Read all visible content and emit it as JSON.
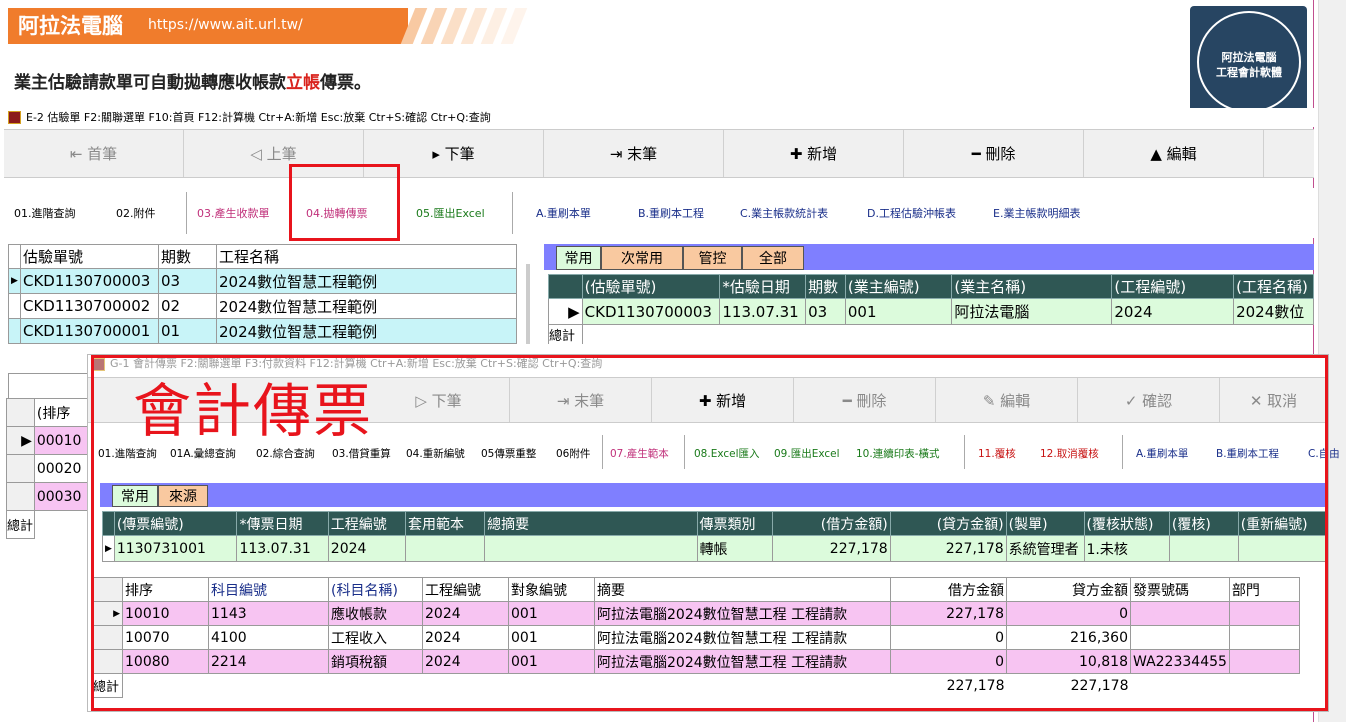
{
  "banner": {
    "title": "阿拉法電腦",
    "url": "https://www.ait.url.tw/"
  },
  "logo": {
    "line1": "阿拉法電腦",
    "line2": "工程會計軟體"
  },
  "subtitle": {
    "pre": "業主估驗請款單可自動拋轉應收帳款",
    "red": "立帳",
    "post": "傳票。"
  },
  "win1": {
    "title": "E-2 估驗單  F2:關聯選單  F10:首頁  F12:計算機  Ctr+A:新增  Esc:放棄  Ctr+S:確認  Ctr+Q:查詢",
    "nav": [
      "⇤ 首筆",
      "◁ 上筆",
      "▸ 下筆",
      "⇥ 末筆",
      "✚ 新增",
      "━ 刪除",
      "▲ 編輯"
    ],
    "funcs": {
      "f1": "01.進階查詢",
      "f2": "02.附件",
      "f3": "03.產生收款單",
      "f4": "04.拋轉傳票",
      "f5": "05.匯出Excel",
      "a": "A.重刷本單",
      "b": "B.重刷本工程",
      "c": "C.業主帳款統計表",
      "d": "D.工程估驗沖帳表",
      "e": "E.業主帳款明細表"
    },
    "left_headers": [
      "估驗單號",
      "期數",
      "工程名稱"
    ],
    "left_rows": [
      [
        "CKD1130700003",
        "03",
        "2024數位智慧工程範例"
      ],
      [
        "CKD1130700002",
        "02",
        "2024數位智慧工程範例"
      ],
      [
        "CKD1130700001",
        "01",
        "2024數位智慧工程範例"
      ]
    ],
    "tabs": [
      "常用",
      "次常用",
      "管控",
      "全部"
    ],
    "right_headers": [
      "(估驗單號)",
      "*估驗日期",
      "期數",
      "(業主編號)",
      "(業主名稱)",
      "(工程編號)",
      "(工程名稱)"
    ],
    "right_row": [
      "CKD1130700003",
      "113.07.31",
      "03",
      "001",
      "阿拉法電腦",
      "2024",
      "2024數位"
    ],
    "total": "總計",
    "sub_header": "(排序",
    "sub_rows": [
      "00010",
      "00020",
      "00030"
    ]
  },
  "win2": {
    "title": "G-1 會計傳票  F2:關聯選單  F3:付款資料  F12:計算機  Ctr+A:新增  Esc:放棄  Ctr+S:確認  Ctr+Q:查詢",
    "stamp": "會計傳票",
    "nav": [
      "▷ 下筆",
      "⇥ 末筆",
      "✚ 新增",
      "━ 刪除",
      "✎ 編輯",
      "✓ 確認",
      "✕ 取消"
    ],
    "funcs": {
      "f1": "01.進階查詢",
      "f1a": "01A.彙總查詢",
      "f2": "02.綜合查詢",
      "f3": "03.借貸重算",
      "f4": "04.重新編號",
      "f5": "05傳票重整",
      "f6": "06附件",
      "f7": "07.產生範本",
      "f8": "08.Excel匯入",
      "f9": "09.匯出Excel",
      "f10": "10.連續印表-橫式",
      "f11": "11.覆核",
      "f12": "12.取消覆核",
      "a": "A.重刷本單",
      "b": "B.重刷本工程",
      "c": "C.自由"
    },
    "tabs": [
      "常用",
      "來源"
    ],
    "head_headers": [
      "(傳票編號)",
      "*傳票日期",
      "工程編號",
      "套用範本",
      "總摘要",
      "傳票類別",
      "(借方金額)",
      "(貸方金額)",
      "(製單)",
      "(覆核狀態)",
      "(覆核)",
      "(重新編號)"
    ],
    "head_row": [
      "1130731001",
      "113.07.31",
      "2024",
      "",
      "",
      "轉帳",
      "227,178",
      "227,178",
      "系統管理者",
      "1.未核",
      "",
      ""
    ],
    "detail_headers": [
      "排序",
      "科目編號",
      "(科目名稱)",
      "工程編號",
      "對象編號",
      "摘要",
      "借方金額",
      "貸方金額",
      "發票號碼",
      "部門"
    ],
    "detail_rows": [
      [
        "10010",
        "1143",
        "應收帳款",
        "2024",
        "001",
        "阿拉法電腦2024數位智慧工程 工程請款",
        "227,178",
        "0",
        "",
        ""
      ],
      [
        "10070",
        "4100",
        "工程收入",
        "2024",
        "001",
        "阿拉法電腦2024數位智慧工程 工程請款",
        "0",
        "216,360",
        "",
        ""
      ],
      [
        "10080",
        "2214",
        "銷項稅額",
        "2024",
        "001",
        "阿拉法電腦2024數位智慧工程 工程請款",
        "0",
        "10,818",
        "WA22334455",
        ""
      ]
    ],
    "total": "總計",
    "total_debit": "227,178",
    "total_credit": "227,178"
  }
}
